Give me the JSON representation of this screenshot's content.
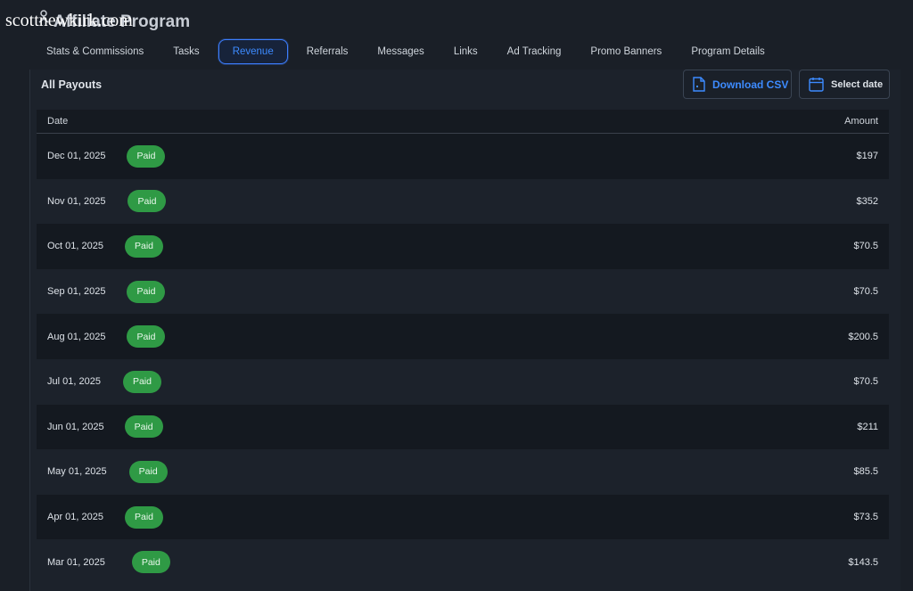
{
  "overlay": {
    "site_label": "scottnewkirk.com"
  },
  "header": {
    "app_title": "Affiliate Program"
  },
  "tabs": [
    {
      "label": "Stats & Commissions",
      "active": false
    },
    {
      "label": "Tasks",
      "active": false
    },
    {
      "label": "Revenue",
      "active": true
    },
    {
      "label": "Referrals",
      "active": false
    },
    {
      "label": "Messages",
      "active": false
    },
    {
      "label": "Links",
      "active": false
    },
    {
      "label": "Ad Tracking",
      "active": false
    },
    {
      "label": "Promo Banners",
      "active": false
    },
    {
      "label": "Program Details",
      "active": false
    }
  ],
  "panel": {
    "title": "All Payouts",
    "download_label": "Download CSV",
    "select_date_label": "Select date"
  },
  "table": {
    "columns": [
      "Date",
      "Amount"
    ],
    "rows": [
      {
        "date": "Dec 01, 2025",
        "status": "Paid",
        "amount": "$197"
      },
      {
        "date": "Nov 01, 2025",
        "status": "Paid",
        "amount": "$352"
      },
      {
        "date": "Oct 01, 2025",
        "status": "Paid",
        "amount": "$70.5"
      },
      {
        "date": "Sep 01, 2025",
        "status": "Paid",
        "amount": "$70.5"
      },
      {
        "date": "Aug 01, 2025",
        "status": "Paid",
        "amount": "$200.5"
      },
      {
        "date": "Jul 01, 2025",
        "status": "Paid",
        "amount": "$70.5"
      },
      {
        "date": "Jun 01, 2025",
        "status": "Paid",
        "amount": "$211"
      },
      {
        "date": "May 01, 2025",
        "status": "Paid",
        "amount": "$85.5"
      },
      {
        "date": "Apr 01, 2025",
        "status": "Paid",
        "amount": "$73.5"
      },
      {
        "date": "Mar 01, 2025",
        "status": "Paid",
        "amount": "$143.5"
      }
    ]
  },
  "colors": {
    "background": "#1a1f27",
    "accent": "#3d8bff",
    "paid_badge": "#2f9a45"
  },
  "icons": {
    "app": "affiliate-link-icon",
    "download": "file-csv-icon",
    "select_date": "calendar-icon"
  }
}
